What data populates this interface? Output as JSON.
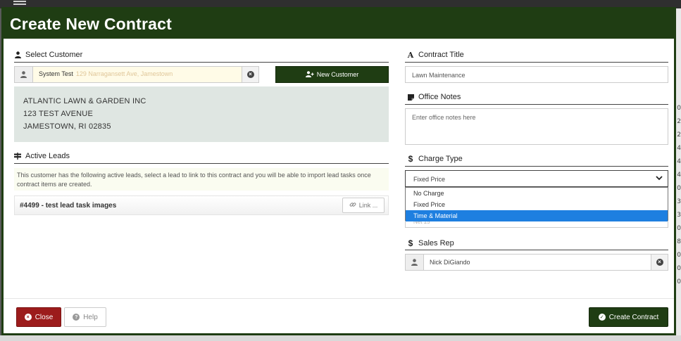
{
  "modal": {
    "title": "Create New Contract"
  },
  "customer": {
    "section_label": "Select Customer",
    "selected_name": "System Test",
    "selected_address": "129 Narragansett Ave, Jamestown",
    "new_customer_label": "New Customer",
    "info_lines": [
      "ATLANTIC LAWN & GARDEN INC",
      "123 TEST AVENUE",
      "JAMESTOWN, RI 02835"
    ]
  },
  "leads": {
    "section_label": "Active Leads",
    "description": "This customer has the following active leads, select a lead to link to this contract and you will be able to import lead tasks once contract items are created.",
    "items": [
      {
        "title": "#4499 - test lead task images",
        "link_label": "Link ..."
      }
    ]
  },
  "contract_title": {
    "section_label": "Contract Title",
    "value": "Lawn Maintenance"
  },
  "office_notes": {
    "section_label": "Office Notes",
    "placeholder": "Enter office notes here"
  },
  "charge_type": {
    "section_label": "Charge Type",
    "selected": "Fixed Price",
    "options": [
      "No Charge",
      "Fixed Price",
      "Time & Material"
    ],
    "highlighted": "Time & Material",
    "behind_text": "Net 15"
  },
  "sales_rep": {
    "section_label": "Sales Rep",
    "value": "Nick DiGiando"
  },
  "footer": {
    "close_label": "Close",
    "help_label": "Help",
    "create_label": "Create Contract"
  },
  "background": {
    "right_digits": [
      "0",
      "2",
      "2",
      "4",
      "4",
      "4",
      "0",
      "3",
      "3",
      "0",
      "8",
      "0",
      "0",
      "0"
    ]
  },
  "colors": {
    "brand_green": "#1f3d13",
    "close_red": "#9c1c1c",
    "highlight_blue": "#1e7fe0"
  }
}
